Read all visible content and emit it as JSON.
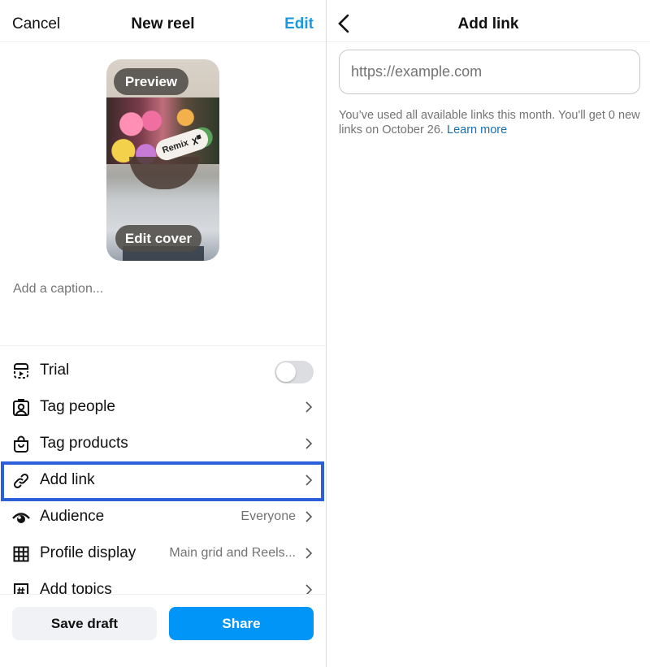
{
  "left": {
    "header": {
      "cancel": "Cancel",
      "title": "New reel",
      "edit": "Edit"
    },
    "preview": {
      "preview_label": "Preview",
      "edit_cover_label": "Edit cover",
      "sticker_label": "Remix"
    },
    "caption": {
      "placeholder": "Add a caption..."
    },
    "rows": [
      {
        "label": "Trial",
        "icon": "reels-trial-icon",
        "toggle_on": false
      },
      {
        "label": "Tag people",
        "icon": "tag-people-icon"
      },
      {
        "label": "Tag products",
        "icon": "shopping-bag-icon"
      },
      {
        "label": "Add link",
        "icon": "link-icon",
        "highlighted": true
      },
      {
        "label": "Audience",
        "icon": "eye-icon",
        "value": "Everyone"
      },
      {
        "label": "Profile display",
        "icon": "grid-icon",
        "value": "Main grid and Reels..."
      },
      {
        "label": "Add topics",
        "icon": "hashtag-icon"
      }
    ],
    "buttons": {
      "save_draft": "Save draft",
      "share": "Share"
    }
  },
  "right": {
    "header": {
      "title": "Add link"
    },
    "url_input": {
      "placeholder": "https://example.com",
      "value": ""
    },
    "note": {
      "text": "You’ve used all available links this month. You'll get 0 new links on October 26.",
      "link": "Learn more"
    }
  },
  "colors": {
    "accent_blue": "#0095f6",
    "edit_blue": "#1a9ae0",
    "highlight": "#2b5fd9",
    "link_blue": "#1a6fb0"
  }
}
